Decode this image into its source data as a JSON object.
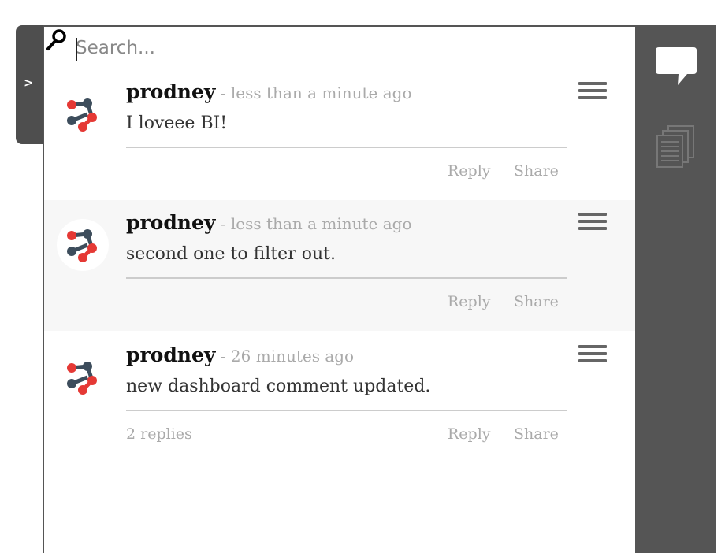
{
  "search": {
    "placeholder": "Search..."
  },
  "collapse_tab": {
    "label": ">"
  },
  "comments": [
    {
      "author": "prodney",
      "separator": " - ",
      "time": "less than a minute ago",
      "text": "I loveee BI!",
      "reply_label": "Reply",
      "share_label": "Share"
    },
    {
      "author": "prodney",
      "separator": " - ",
      "time": "less than a minute ago",
      "text": "second one to filter out.",
      "reply_label": "Reply",
      "share_label": "Share"
    },
    {
      "author": "prodney",
      "separator": " - ",
      "time": "26 minutes ago",
      "text": "new dashboard comment updated.",
      "replies_label": "2 replies",
      "reply_label": "Reply",
      "share_label": "Share"
    }
  ],
  "colors": {
    "sidebar": "#555555",
    "avatar_red": "#e53935",
    "avatar_slate": "#3d4d5c",
    "muted_text": "#aaaaaa"
  },
  "icons": {
    "search": "search-icon",
    "chat": "chat-bubble-icon",
    "documents": "documents-icon",
    "menu": "hamburger-menu-icon",
    "avatar": "network-avatar-icon"
  }
}
